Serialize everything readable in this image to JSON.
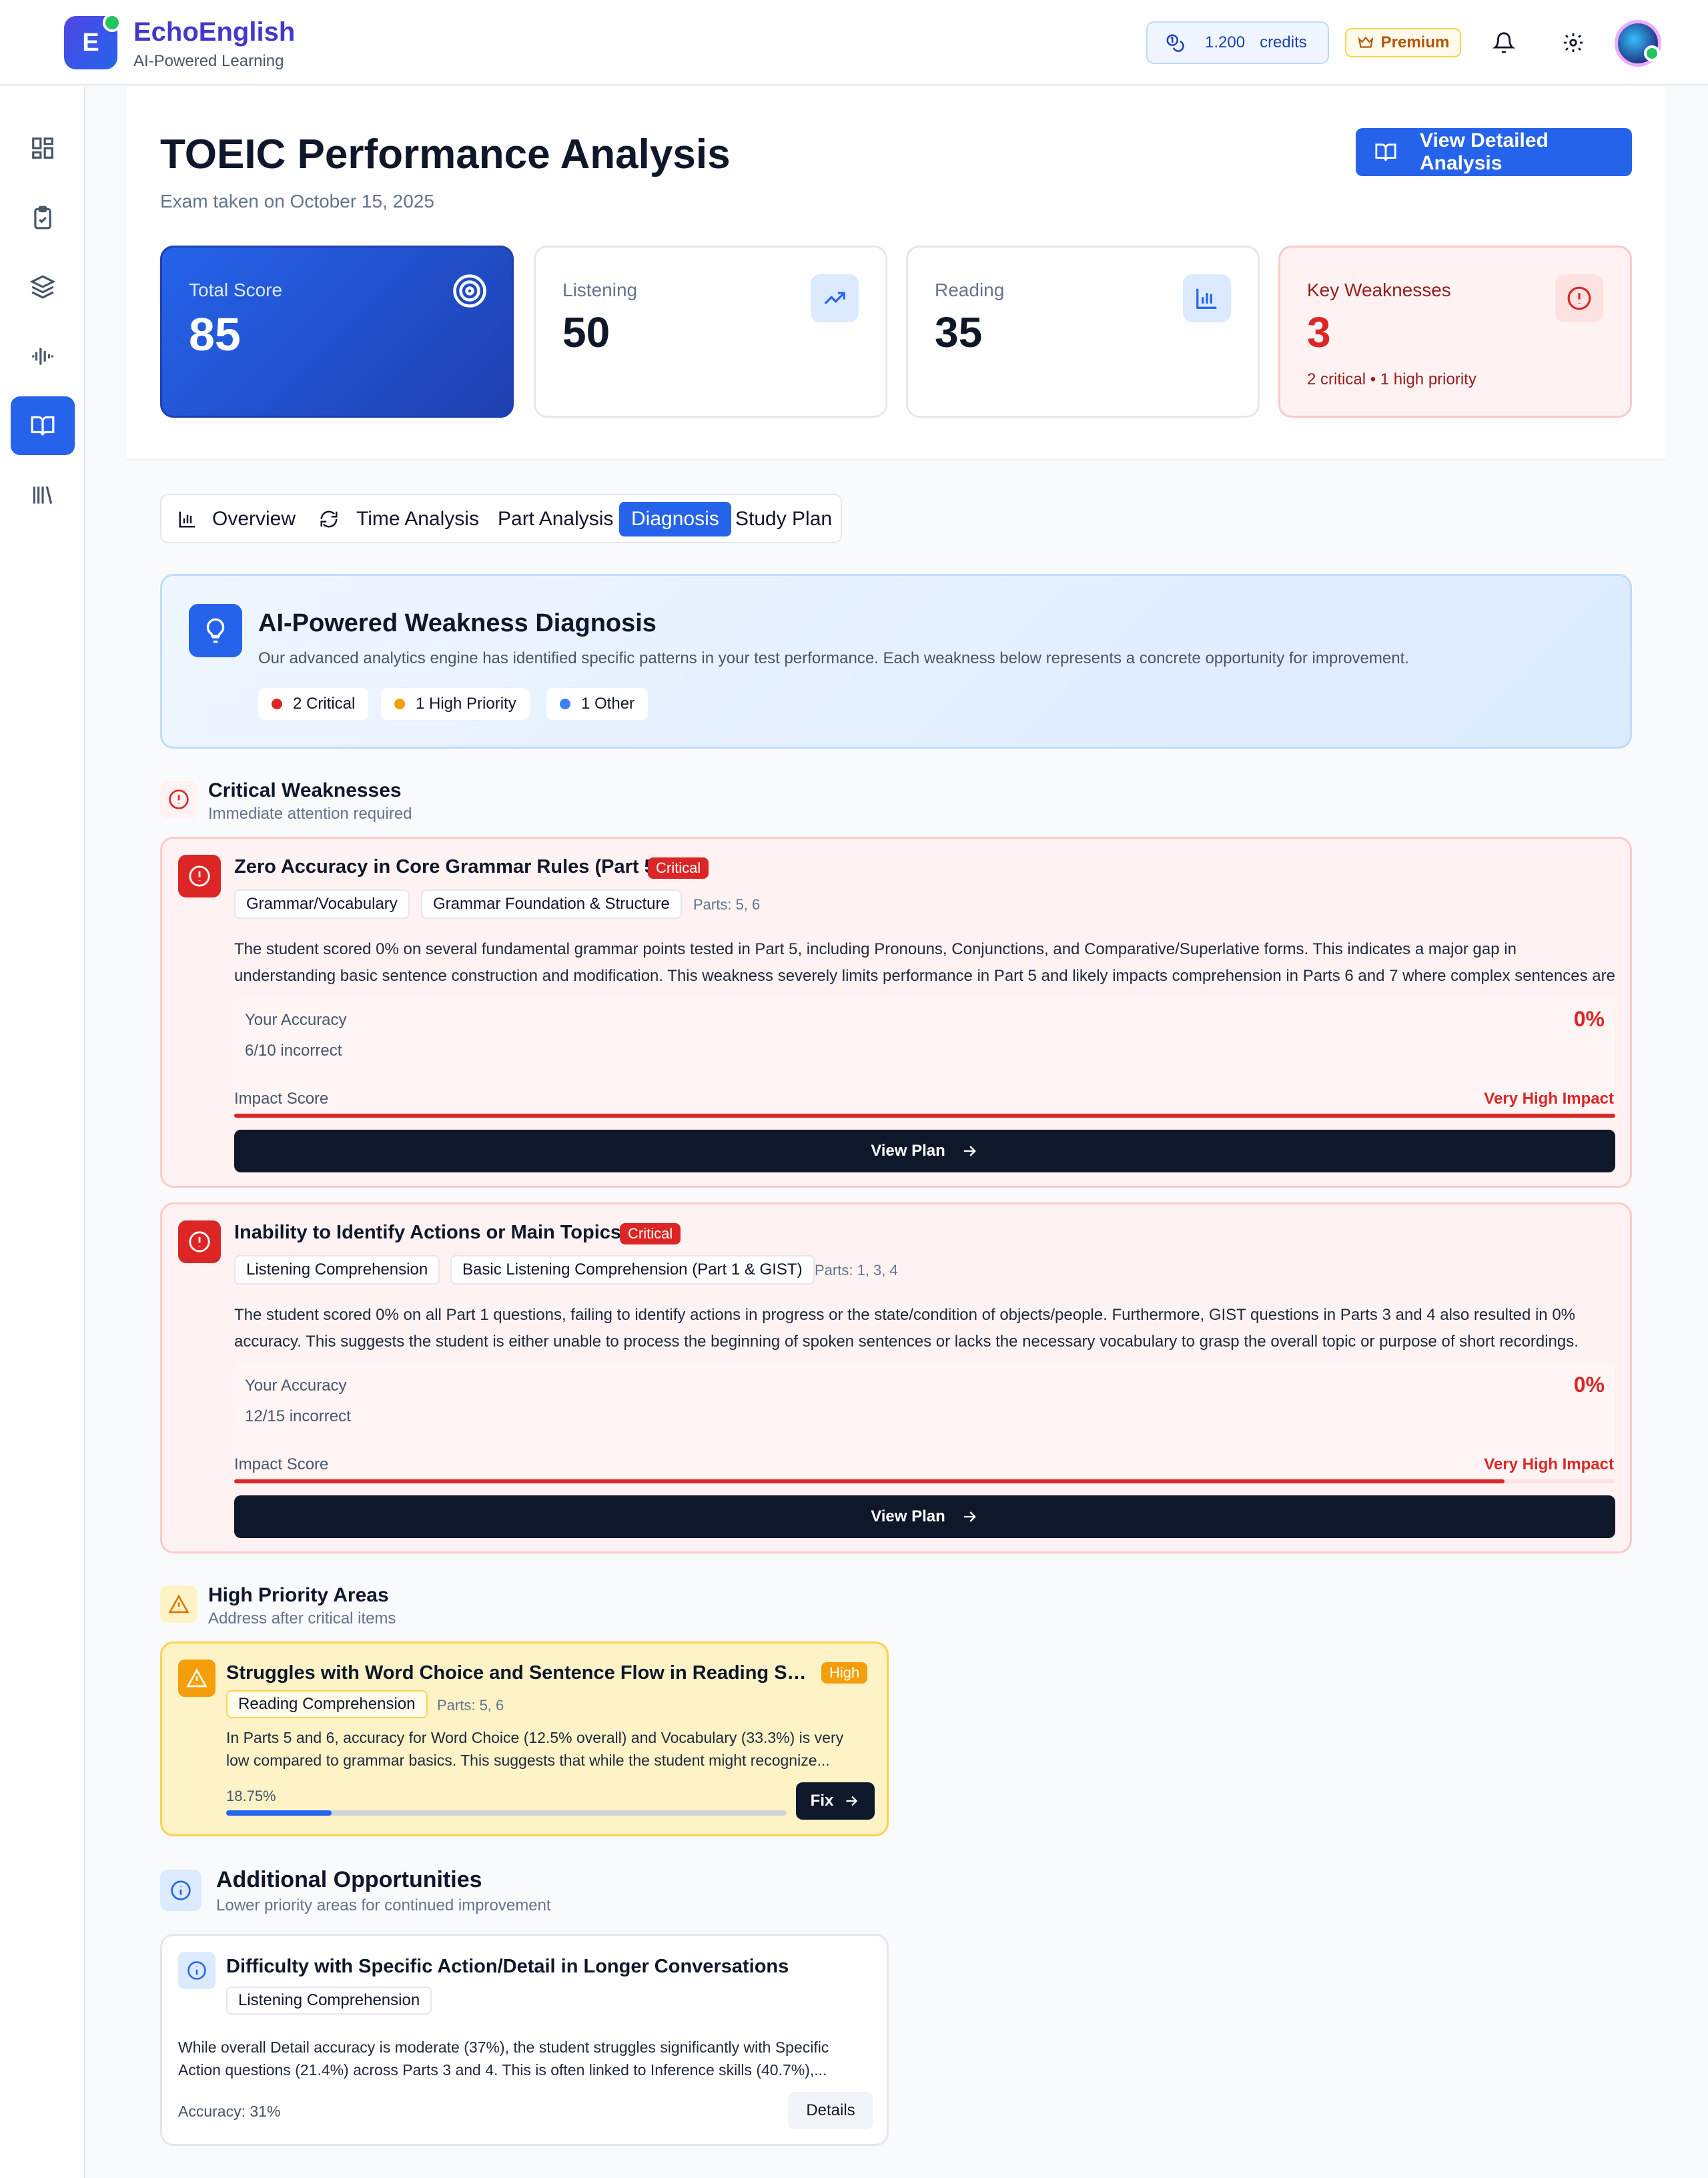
{
  "app": {
    "name": "EchoEnglish",
    "tagline": "AI-Powered Learning",
    "logo_letter": "E"
  },
  "header": {
    "credits_value": "1.200",
    "credits_label": "credits",
    "premium_label": "Premium"
  },
  "page": {
    "title": "TOEIC Performance Analysis",
    "subtitle": "Exam taken on October 15, 2025",
    "detail_button": "View Detailed Analysis"
  },
  "stats": {
    "total": {
      "label": "Total Score",
      "value": "85"
    },
    "listening": {
      "label": "Listening",
      "value": "50"
    },
    "reading": {
      "label": "Reading",
      "value": "35"
    },
    "weaknesses": {
      "label": "Key Weaknesses",
      "value": "3",
      "note": "2 critical • 1 high priority"
    }
  },
  "tabs": [
    "Overview",
    "Time Analysis",
    "Part Analysis",
    "Diagnosis",
    "Study Plan"
  ],
  "active_tab": "Diagnosis",
  "diagnosis": {
    "title": "AI-Powered Weakness Diagnosis",
    "description": "Our advanced analytics engine has identified specific patterns in your test performance. Each weakness below represents a concrete opportunity for improvement.",
    "chips": [
      {
        "label": "2 Critical",
        "color": "#dc2626"
      },
      {
        "label": "1 High Priority",
        "color": "#f59e0b"
      },
      {
        "label": "1 Other",
        "color": "#3b82f6"
      }
    ]
  },
  "critical": {
    "title": "Critical Weaknesses",
    "subtitle": "Immediate attention required",
    "items": [
      {
        "title": "Zero Accuracy in Core Grammar Rules (Part 5)",
        "badge": "Critical",
        "tags": [
          "Grammar/Vocabulary",
          "Grammar Foundation & Structure"
        ],
        "parts": "Parts: 5, 6",
        "description": "The student scored 0% on several fundamental grammar points tested in Part 5, including Pronouns, Conjunctions, and Comparative/Superlative forms. This indicates a major gap in understanding basic sentence construction and modification. This weakness severely limits performance in Part 5 and likely impacts comprehension in Parts 6 and 7 where complex sentences are common.",
        "accuracy_label": "Your Accuracy",
        "accuracy_value": "0%",
        "incorrect": "6/10 incorrect",
        "impact_label": "Impact Score",
        "impact_value": "Very High Impact",
        "impact_fraction": 1.0,
        "button": "View Plan"
      },
      {
        "title": "Inability to Identify Actions or Main Topics",
        "badge": "Critical",
        "tags": [
          "Listening Comprehension",
          "Basic Listening Comprehension (Part 1 & GIST)"
        ],
        "parts": "Parts: 1, 3, 4",
        "description": "The student scored 0% on all Part 1 questions, failing to identify actions in progress or the state/condition of objects/people. Furthermore, GIST questions in Parts 3 and 4 also resulted in 0% accuracy. This suggests the student is either unable to process the beginning of spoken sentences or lacks the necessary vocabulary to grasp the overall topic or purpose of short recordings.",
        "accuracy_label": "Your Accuracy",
        "accuracy_value": "0%",
        "incorrect": "12/15 incorrect",
        "impact_label": "Impact Score",
        "impact_value": "Very High Impact",
        "impact_fraction": 0.92,
        "button": "View Plan"
      }
    ]
  },
  "high_priority": {
    "title": "High Priority Areas",
    "subtitle": "Address after critical items",
    "item": {
      "title": "Struggles with Word Choice and Sentence Flow in Reading Sections",
      "badge": "High",
      "tag": "Reading Comprehension",
      "parts": "Parts: 5, 6",
      "description": "In Parts 5 and 6, accuracy for Word Choice (12.5% overall) and Vocabulary (33.3%) is very low compared to grammar basics. This suggests that while the student might recognize...",
      "progress_label": "18.75%",
      "progress_fraction": 0.1875,
      "button": "Fix"
    }
  },
  "additional": {
    "title": "Additional Opportunities",
    "subtitle": "Lower priority areas for continued improvement",
    "item": {
      "title": "Difficulty with Specific Action/Detail in Longer Conversations",
      "tag": "Listening Comprehension",
      "description": "While overall Detail accuracy is moderate (37%), the student struggles significantly with Specific Action questions (21.4%) across Parts 3 and 4. This is often linked to Inference skills (40.7%),...",
      "accuracy": "Accuracy: 31%",
      "button": "Details"
    }
  },
  "sidebar": {
    "icons": [
      "dashboard-icon",
      "clipboard-check-icon",
      "layers-icon",
      "audio-waveform-icon",
      "book-open-icon",
      "library-icon"
    ],
    "active": "book-open-icon"
  }
}
